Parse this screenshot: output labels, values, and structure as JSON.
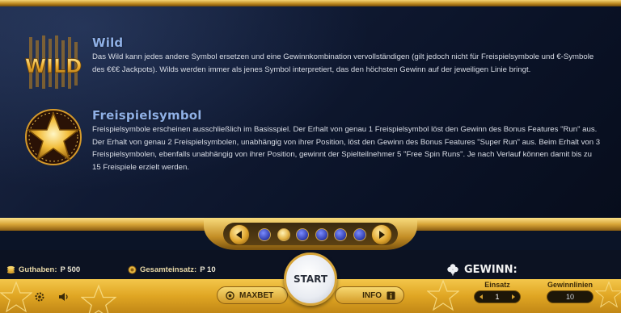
{
  "sections": {
    "wild": {
      "title": "Wild",
      "text": "Das Wild kann jedes andere Symbol ersetzen und eine Gewinnkombination vervollständigen (gilt jedoch nicht für Freispielsymbole und €-Symbole des €€€ Jackpots). Wilds werden immer als jenes Symbol interpretiert, das den höchsten Gewinn auf der jeweiligen Linie bringt.",
      "symbol_text": "WILD"
    },
    "freispiel": {
      "title": "Freispielsymbol",
      "text": "Freispielsymbole erscheinen ausschließlich im Basisspiel. Der Erhalt von genau 1 Freispielsymbol löst den Gewinn des Bonus Features \"Run\" aus. Der Erhalt von genau 2 Freispielsymbolen, unabhängig von ihrer Position, löst den Gewinn des Bonus Features \"Super Run\" aus. Beim Erhalt von 3 Freispielsymbolen, ebenfalls unabhängig von ihrer Position, gewinnt der Spielteilnehmer 5 \"Free Spin Runs\". Je nach Verlauf können damit bis zu 15 Freispiele erzielt werden."
    }
  },
  "pager": {
    "total_pages": 6,
    "active_index": 1
  },
  "status": {
    "guthaben_label": "Guthaben:",
    "guthaben_value": "P 500",
    "einsatz_label": "Gesamteinsatz:",
    "einsatz_value": "P 10",
    "gewinn_label": "GEWINN:"
  },
  "controls": {
    "maxbet_label": "MAXBET",
    "start_label": "START",
    "info_label": "INFO",
    "einsatz_label": "Einsatz",
    "einsatz_value": "1",
    "linien_label": "Gewinnlinien",
    "linien_value": "10"
  },
  "colors": {
    "gold": "#e0a623",
    "title_blue": "#8fb0e6",
    "panel_dark": "#0b1427"
  }
}
